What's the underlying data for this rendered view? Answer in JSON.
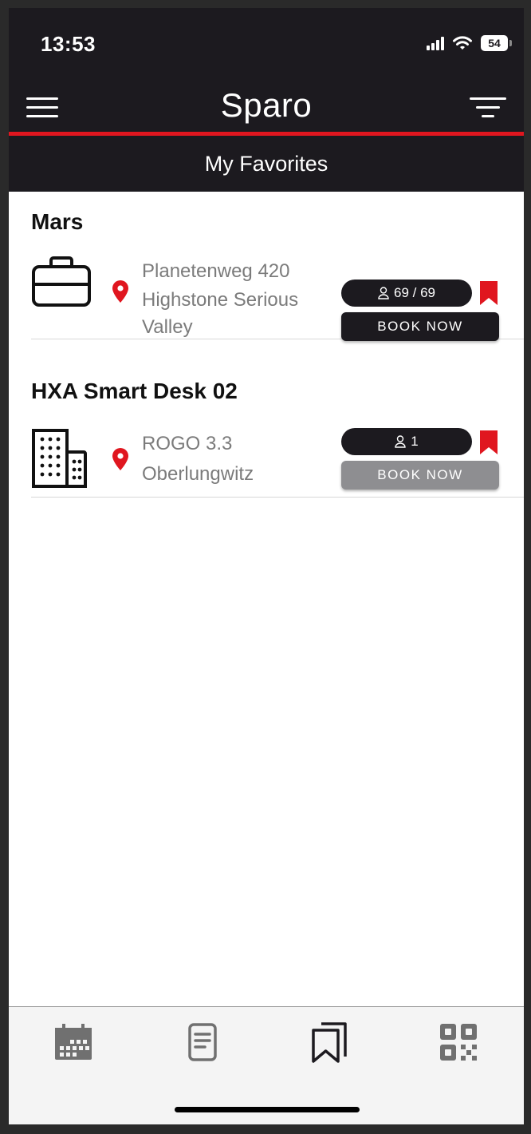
{
  "status_bar": {
    "time": "13:53",
    "battery": "54"
  },
  "header": {
    "title": "Sparo",
    "subtitle": "My Favorites"
  },
  "favorites": [
    {
      "name": "Mars",
      "type_icon": "briefcase-icon",
      "address_lines": [
        "Planetenweg 420",
        "Highstone Serious",
        "Valley"
      ],
      "capacity": "69 / 69",
      "book_label": "BOOK NOW",
      "book_enabled": true
    },
    {
      "name": "HXA Smart Desk 02",
      "type_icon": "building-icon",
      "address_lines": [
        "ROGO 3.3",
        "Oberlungwitz"
      ],
      "capacity": "1",
      "book_label": "BOOK NOW",
      "book_enabled": false
    }
  ],
  "tabs": [
    {
      "icon": "calendar-icon",
      "active": false
    },
    {
      "icon": "document-icon",
      "active": false
    },
    {
      "icon": "bookmarks-icon",
      "active": true
    },
    {
      "icon": "qr-code-icon",
      "active": false
    }
  ],
  "colors": {
    "header_bg": "#1c1a1f",
    "accent_red": "#e0161f",
    "text_muted": "#7b7b7b",
    "button_disabled": "#8e8e91"
  }
}
